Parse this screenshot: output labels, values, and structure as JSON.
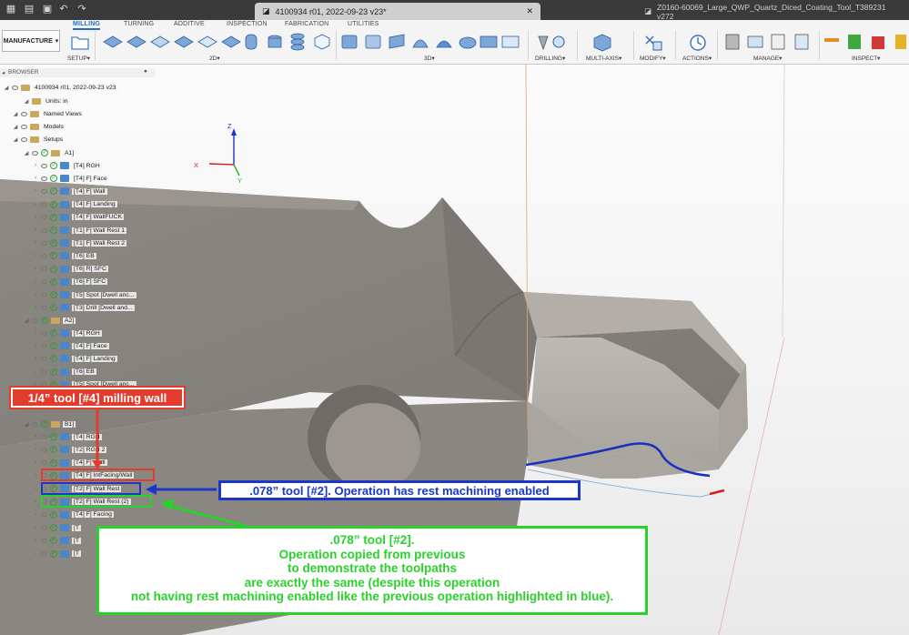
{
  "window": {
    "active_tab": "4100934 r01, 2022-09-23 v23*",
    "inactive_tab": "Z0160-60069_Large_QWP_Quartz_Diced_Coating_Tool_T389231 v272"
  },
  "ribbon": {
    "workspace": "MANUFACTURE",
    "tabs": [
      "MILLING",
      "TURNING",
      "ADDITIVE",
      "INSPECTION",
      "FABRICATION",
      "UTILITIES"
    ],
    "groups": {
      "setup": "SETUP",
      "g2d": "2D",
      "g3d": "3D",
      "drilling": "DRILLING",
      "multiaxis": "MULTI-AXIS",
      "modify": "MODIFY",
      "actions": "ACTIONS",
      "manage": "MANAGE",
      "inspect": "INSPECT"
    }
  },
  "browser": {
    "header": "BROWSER",
    "root": "4100934 r01, 2022-09-23 v23",
    "units": "Units: in",
    "named_views": "Named Views",
    "models": "Models",
    "setups": "Setups",
    "setup_a1": "A1]",
    "a1_ops": [
      "[T4] RGH",
      "[T4] F] Face",
      "[T4] F] Wall",
      "[T4] F] Landing",
      "[T4] F] WallFUCK",
      "[T1] F] Wall Rest 1",
      "[T1] F] Wall Rest 2",
      "[T6] EB",
      "[T6] R] SFC",
      "[T6] F] SFC",
      "[T5] Spot [Dwell anc...",
      "[T3] Drill [Dwell and..."
    ],
    "setup_a2": "A2]",
    "a2_ops": [
      "[T4] RGH",
      "[T4] F] Face",
      "[T4] F] Landing",
      "[T6] EB",
      "[T5] Spot [Dwell anc..."
    ],
    "setup_b1": "B1]",
    "b1_ops": [
      "[T4] RGH",
      "[T2] RGH 2",
      "[T4] F] Wall",
      "[T4] F] IntFacing/Wall",
      "[T2] F] Wall Rest",
      "[T2] F] Wall Rest (2)",
      "[T4] F] Facing",
      "[T",
      "[T",
      "[T"
    ]
  },
  "triad": {
    "z": "Z",
    "x": "X",
    "y": "Y"
  },
  "annotations": {
    "red": "1/4” tool [#4] milling wall",
    "blue": ".078” tool [#2]. Operation has rest machining enabled",
    "green_lines": [
      ".078” tool [#2].",
      "Operation copied from previous",
      "to demonstrate the toolpaths",
      "are exactly the same (despite this operation",
      "not having rest machining enabled like the previous operation highlighted in blue)."
    ]
  },
  "colors": {
    "accent": "#1f6fc4",
    "annotation_red": "#e33b2c",
    "annotation_blue": "#1c36c9",
    "annotation_green": "#2bd12b",
    "toolpath_blue": "#1a2fc0"
  }
}
